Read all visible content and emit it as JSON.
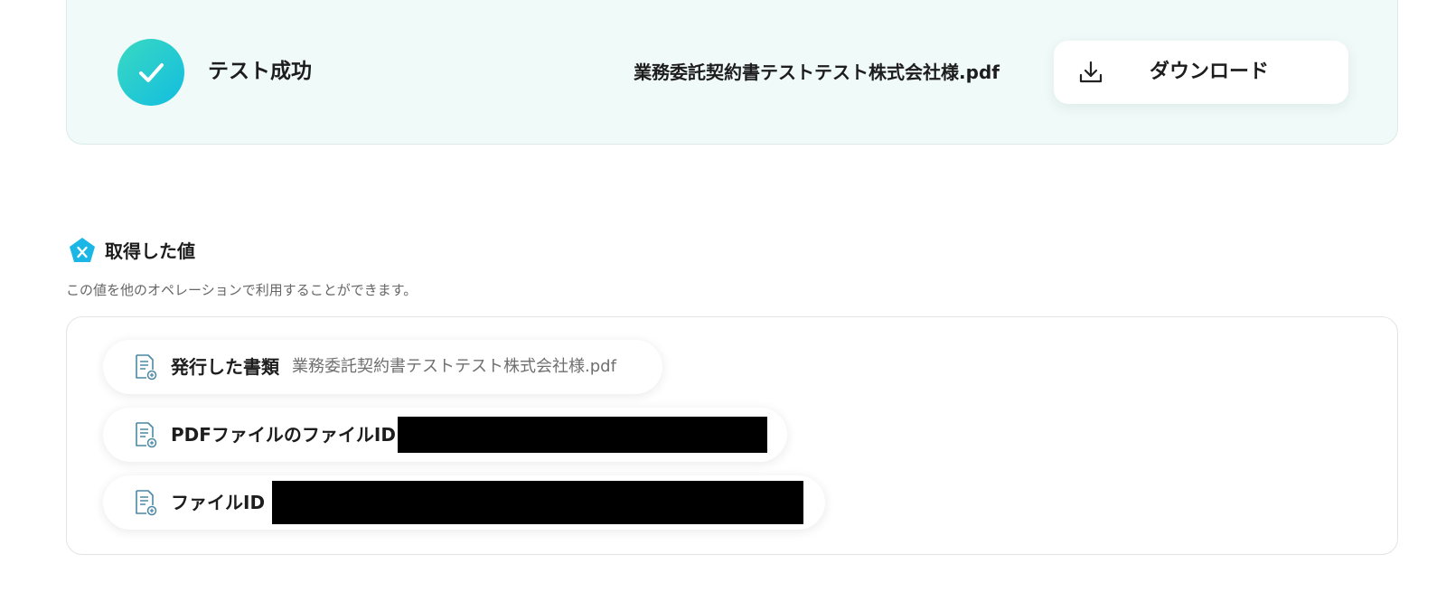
{
  "test_result": {
    "status_label": "テスト成功",
    "file_name": "業務委託契約書テストテスト株式会社様.pdf",
    "download_label": "ダウンロード",
    "colors": {
      "panel_background": "#f0faf8",
      "check_gradient_start": "#3ad9c1",
      "check_gradient_end": "#12bde0"
    }
  },
  "output_section": {
    "title": "取得した値",
    "description": "この値を他のオペレーションで利用することができます。",
    "icon": "variable-x-icon",
    "icon_color": "#1ab7e6",
    "items": [
      {
        "icon": "document-icon",
        "label": "発行した書類",
        "value": "業務委託契約書テストテスト株式会社様.pdf"
      },
      {
        "icon": "document-icon",
        "label": "PDFファイルのファイルID",
        "value_redacted": true
      },
      {
        "icon": "document-icon",
        "label": "ファイルID",
        "value_redacted": true
      }
    ]
  }
}
